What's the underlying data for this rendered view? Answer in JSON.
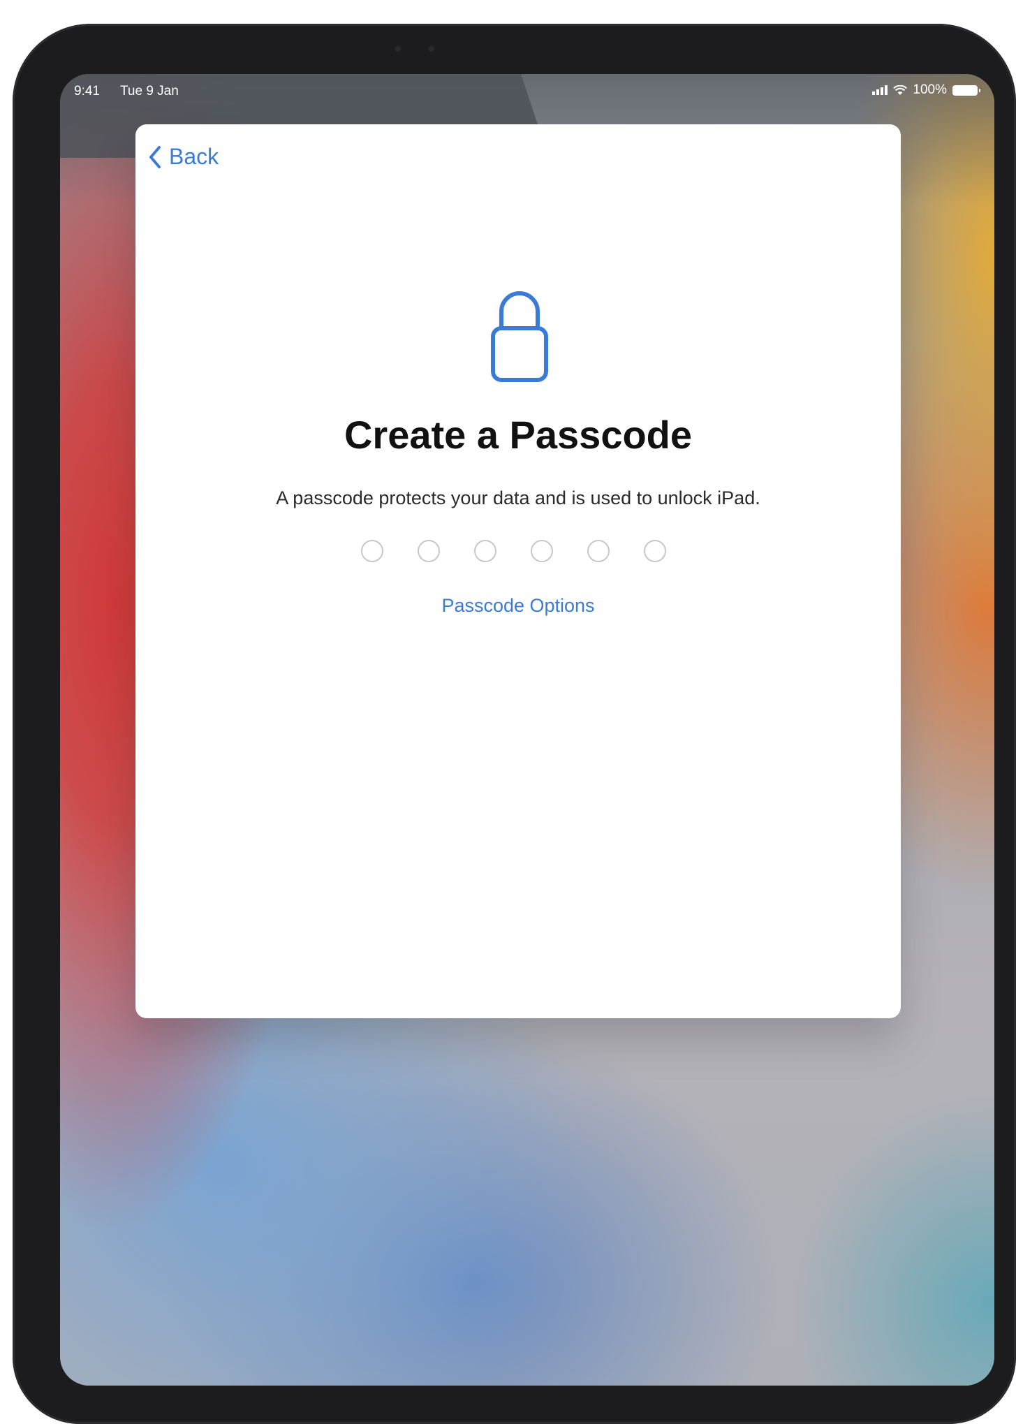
{
  "status_bar": {
    "time": "9:41",
    "date": "Tue 9 Jan",
    "battery": "100%"
  },
  "sheet": {
    "back_label": "Back",
    "title": "Create a Passcode",
    "subtitle": "A passcode protects your data and is used to unlock iPad.",
    "passcode_length": 6,
    "options_label": "Passcode Options"
  },
  "colors": {
    "accent": "#3a7bd5",
    "title_text": "#111111",
    "dot_outline": "#c8c8cc"
  },
  "icons": [
    "chevron-left-icon",
    "lock-icon",
    "cellular-signal-icon",
    "wifi-icon",
    "battery-icon"
  ]
}
